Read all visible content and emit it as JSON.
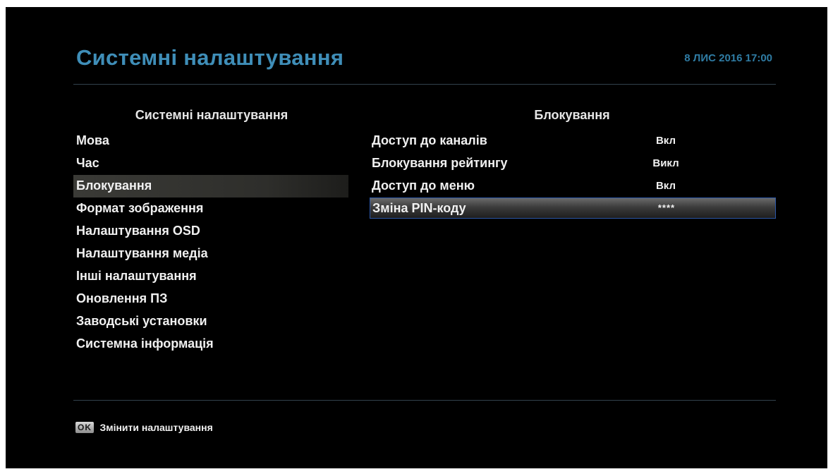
{
  "header": {
    "title": "Системні налаштування",
    "datetime": "8 ЛИС 2016 17:00"
  },
  "left_panel": {
    "heading": "Системні налаштування",
    "items": [
      {
        "label": "Мова"
      },
      {
        "label": "Час"
      },
      {
        "label": "Блокування",
        "active": true
      },
      {
        "label": "Формат зображення"
      },
      {
        "label": "Налаштування OSD"
      },
      {
        "label": "Налаштування медіа"
      },
      {
        "label": "Інші налаштування"
      },
      {
        "label": "Оновлення ПЗ"
      },
      {
        "label": "Заводські установки"
      },
      {
        "label": "Системна інформація"
      }
    ]
  },
  "right_panel": {
    "heading": "Блокування",
    "items": [
      {
        "label": "Доступ до каналів",
        "value": "Вкл"
      },
      {
        "label": "Блокування рейтингу",
        "value": "Викл"
      },
      {
        "label": "Доступ до меню",
        "value": "Вкл"
      },
      {
        "label": "Зміна PIN-коду",
        "value": "****",
        "selected": true
      }
    ]
  },
  "footer": {
    "key": "OK",
    "label": "Змінити налаштування"
  },
  "colors": {
    "background": "#000000",
    "title": "#3f8eb8",
    "datetime": "#2f7ca4",
    "selection_border": "#2c57a8"
  }
}
